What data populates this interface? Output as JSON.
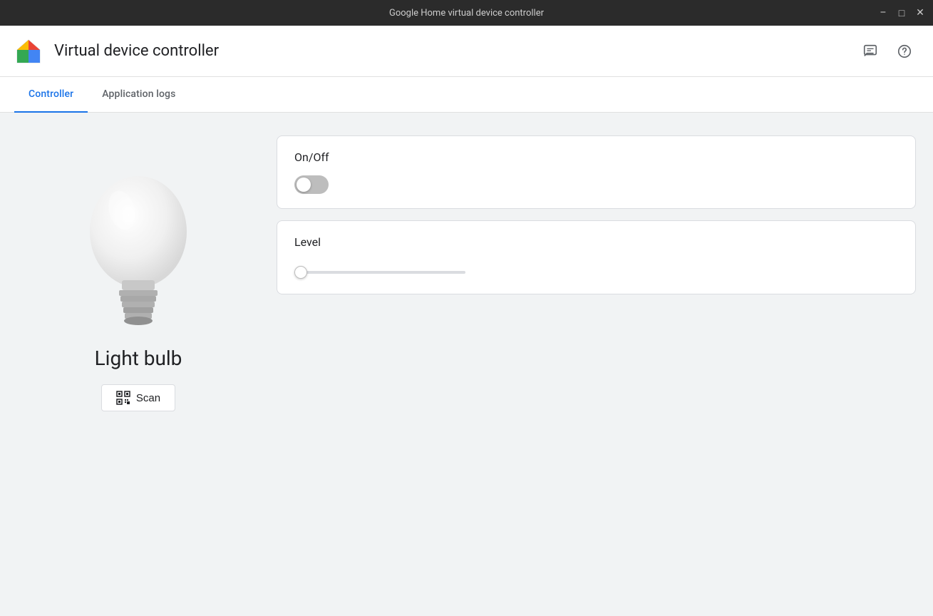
{
  "titlebar": {
    "title": "Google Home virtual device controller",
    "minimize_label": "minimize",
    "maximize_label": "maximize",
    "close_label": "close"
  },
  "header": {
    "title": "Virtual device controller",
    "feedback_icon": "feedback-icon",
    "help_icon": "help-icon"
  },
  "tabs": [
    {
      "id": "controller",
      "label": "Controller",
      "active": true
    },
    {
      "id": "application-logs",
      "label": "Application logs",
      "active": false
    }
  ],
  "left_panel": {
    "device_name": "Light bulb",
    "scan_button_label": "Scan"
  },
  "controls": [
    {
      "id": "on-off",
      "label": "On/Off",
      "type": "toggle",
      "value": false
    },
    {
      "id": "level",
      "label": "Level",
      "type": "slider",
      "value": 0,
      "min": 0,
      "max": 100
    }
  ]
}
